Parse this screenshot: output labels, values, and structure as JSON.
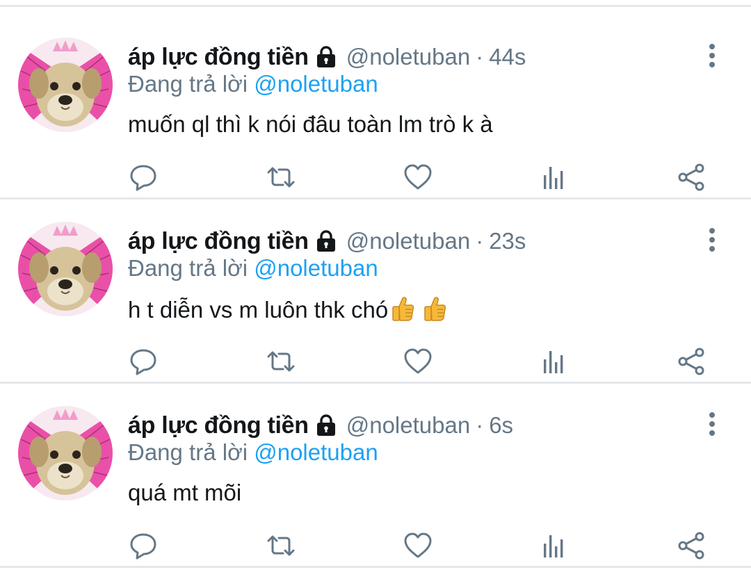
{
  "colors": {
    "text_primary": "#14171a",
    "text_secondary": "#657786",
    "accent": "#1da1f2",
    "divider": "#e4e8eb",
    "icon": "#657786"
  },
  "tweets": [
    {
      "name": "áp lực đồng tiền",
      "handle": "@noletuban",
      "separator": "·",
      "time": "44s",
      "reply_prefix": "Đang trả lời",
      "reply_mention": "@noletuban",
      "text": "muốn ql thì k nói đâu toàn lm trò k à",
      "emojis": []
    },
    {
      "name": "áp lực đồng tiền",
      "handle": "@noletuban",
      "separator": "·",
      "time": "23s",
      "reply_prefix": "Đang trả lời",
      "reply_mention": "@noletuban",
      "text": "h t diễn vs m luôn thk chó",
      "emojis": [
        "thumbs-up",
        "thumbs-up"
      ]
    },
    {
      "name": "áp lực đồng tiền",
      "handle": "@noletuban",
      "separator": "·",
      "time": "6s",
      "reply_prefix": "Đang trả lời",
      "reply_mention": "@noletuban",
      "text": "quá mt mõi",
      "emojis": []
    }
  ],
  "icons": {
    "protected": "lock-icon",
    "more": "more-vertical-icon",
    "reply": "reply-icon",
    "retweet": "retweet-icon",
    "like": "heart-icon",
    "analytics": "analytics-icon",
    "share": "share-icon"
  }
}
